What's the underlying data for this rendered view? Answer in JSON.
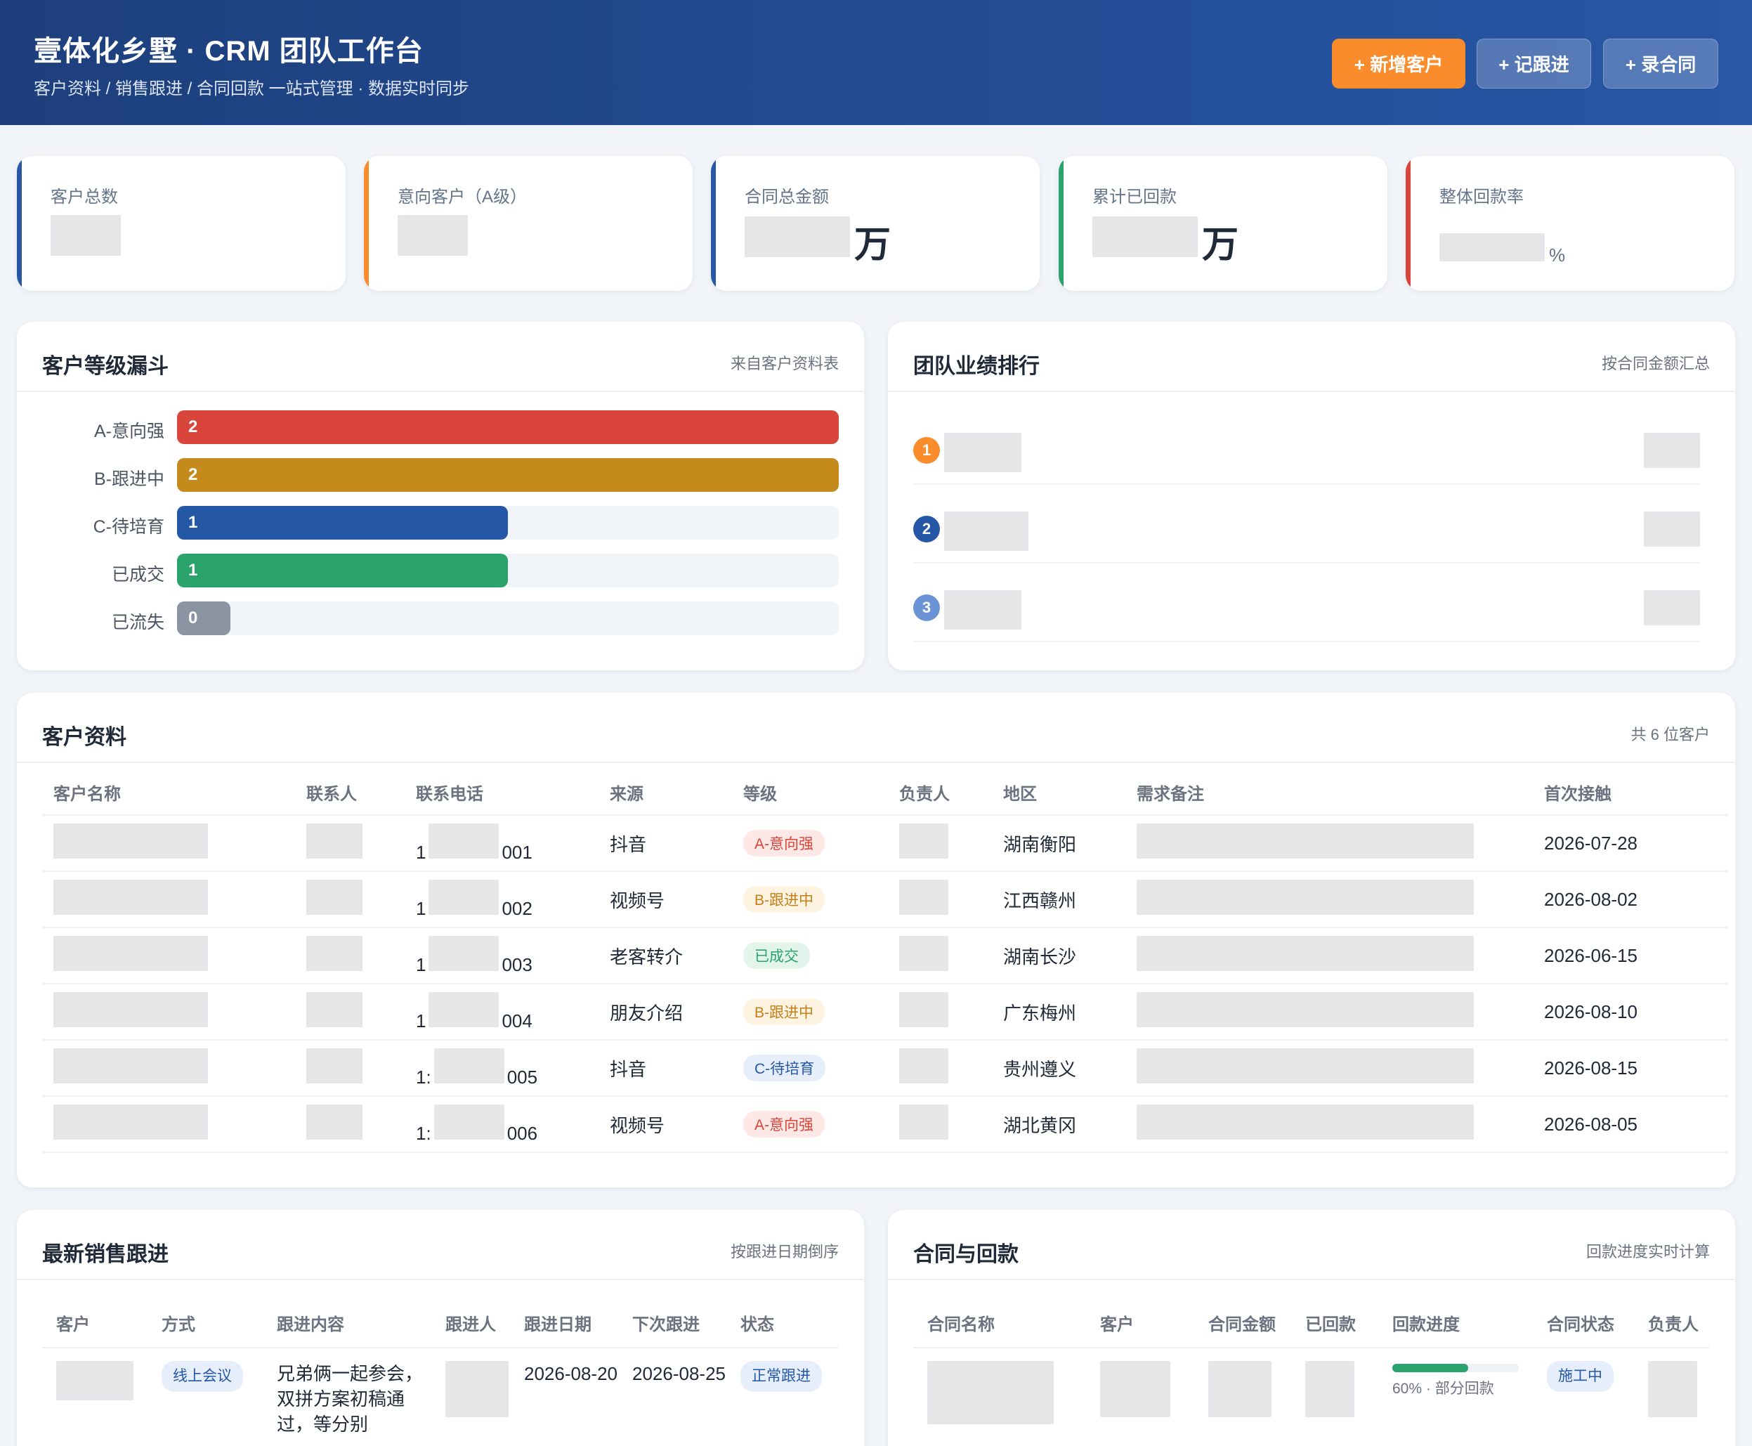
{
  "header": {
    "title": "壹体化乡墅 · CRM 团队工作台",
    "subtitle": "客户资料 / 销售跟进 / 合同回款 一站式管理 · 数据实时同步",
    "buttons": {
      "add_customer": "+ 新增客户",
      "add_followup": "+ 记跟进",
      "add_contract": "+ 录合同"
    }
  },
  "stats": [
    {
      "label": "客户总数",
      "suffix": "",
      "color": "#2857a6"
    },
    {
      "label": "意向客户（A级）",
      "suffix": "",
      "color": "#fb8c2b"
    },
    {
      "label": "合同总金额",
      "suffix": "万",
      "color": "#2857a6"
    },
    {
      "label": "累计已回款",
      "suffix": "万",
      "color": "#2aa26b"
    },
    {
      "label": "整体回款率",
      "suffix": "%",
      "color": "#d9453b"
    }
  ],
  "funnel": {
    "title": "客户等级漏斗",
    "note": "来自客户资料表",
    "items": [
      {
        "label": "A-意向强",
        "value": 2,
        "color": "#d9453b"
      },
      {
        "label": "B-跟进中",
        "value": 2,
        "color": "#c58a1c"
      },
      {
        "label": "C-待培育",
        "value": 1,
        "color": "#2457a6"
      },
      {
        "label": "已成交",
        "value": 1,
        "color": "#2aa26b"
      },
      {
        "label": "已流失",
        "value": 0,
        "color": "#8a94a3"
      }
    ],
    "max": 2
  },
  "ranking": {
    "title": "团队业绩排行",
    "note": "按合同金额汇总",
    "items": [
      {
        "rank": "1",
        "color": "#fb8c2b"
      },
      {
        "rank": "2",
        "color": "#2457a6"
      },
      {
        "rank": "3",
        "color": "#6b93d6"
      }
    ]
  },
  "customers": {
    "title": "客户资料",
    "note": "共 6 位客户",
    "columns": [
      "客户名称",
      "联系人",
      "联系电话",
      "来源",
      "等级",
      "负责人",
      "地区",
      "需求备注",
      "首次接触"
    ],
    "rows": [
      {
        "phone_head": "1",
        "phone_tail": "001",
        "source": "抖音",
        "grade": "A-意向强",
        "grade_cls": "t-a",
        "region": "湖南衡阳",
        "date": "2026-07-28"
      },
      {
        "phone_head": "1",
        "phone_tail": "002",
        "source": "视频号",
        "grade": "B-跟进中",
        "grade_cls": "t-b",
        "region": "江西赣州",
        "date": "2026-08-02"
      },
      {
        "phone_head": "1",
        "phone_tail": "003",
        "source": "老客转介",
        "grade": "已成交",
        "grade_cls": "t-d",
        "region": "湖南长沙",
        "date": "2026-06-15"
      },
      {
        "phone_head": "1",
        "phone_tail": "004",
        "source": "朋友介绍",
        "grade": "B-跟进中",
        "grade_cls": "t-b",
        "region": "广东梅州",
        "date": "2026-08-10"
      },
      {
        "phone_head": "1:",
        "phone_tail": "005",
        "source": "抖音",
        "grade": "C-待培育",
        "grade_cls": "t-c",
        "region": "贵州遵义",
        "date": "2026-08-15"
      },
      {
        "phone_head": "1:",
        "phone_tail": "006",
        "source": "视频号",
        "grade": "A-意向强",
        "grade_cls": "t-a",
        "region": "湖北黄冈",
        "date": "2026-08-05"
      }
    ]
  },
  "followups": {
    "title": "最新销售跟进",
    "note": "按跟进日期倒序",
    "columns": [
      "客户",
      "方式",
      "跟进内容",
      "跟进人",
      "跟进日期",
      "下次跟进",
      "状态"
    ],
    "rows": [
      {
        "method": "线上会议",
        "content": "兄弟俩一起参会，双拼方案初稿通过，等分别",
        "date": "2026-08-20",
        "next": "2026-08-25",
        "status": "正常跟进"
      }
    ]
  },
  "contracts": {
    "title": "合同与回款",
    "note": "回款进度实时计算",
    "columns": [
      "合同名称",
      "客户",
      "合同金额",
      "已回款",
      "回款进度",
      "合同状态",
      "负责人"
    ],
    "rows": [
      {
        "progress": 0.6,
        "progress_text": "60% · 部分回款",
        "status": "施工中"
      }
    ]
  }
}
